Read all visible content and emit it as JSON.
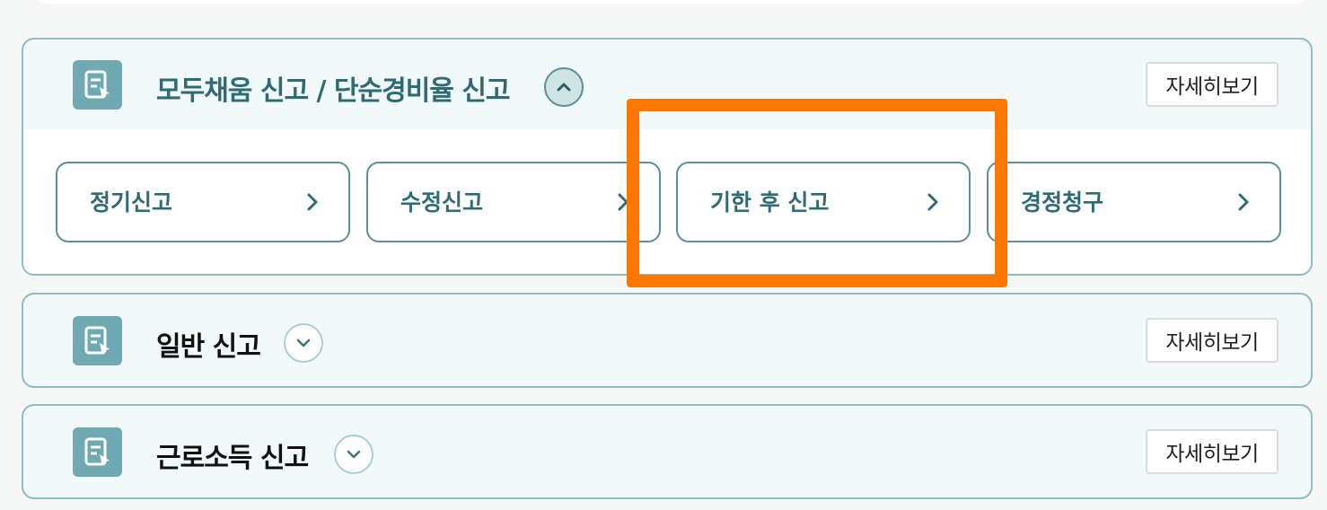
{
  "accent_color": "#2f6b73",
  "highlight_color": "#ff7700",
  "sections": [
    {
      "title": "모두채움 신고 / 단순경비율 신고",
      "toggle_icon": "chevron-up-icon",
      "expanded": true,
      "detail_label": "자세히보기",
      "sub_items": [
        {
          "label": "정기신고"
        },
        {
          "label": "수정신고"
        },
        {
          "label": "기한 후 신고"
        },
        {
          "label": "경정청구"
        }
      ]
    },
    {
      "title": "일반 신고",
      "toggle_icon": "chevron-down-icon",
      "expanded": false,
      "detail_label": "자세히보기"
    },
    {
      "title": "근로소득 신고",
      "toggle_icon": "chevron-down-icon",
      "expanded": false,
      "detail_label": "자세히보기"
    }
  ]
}
